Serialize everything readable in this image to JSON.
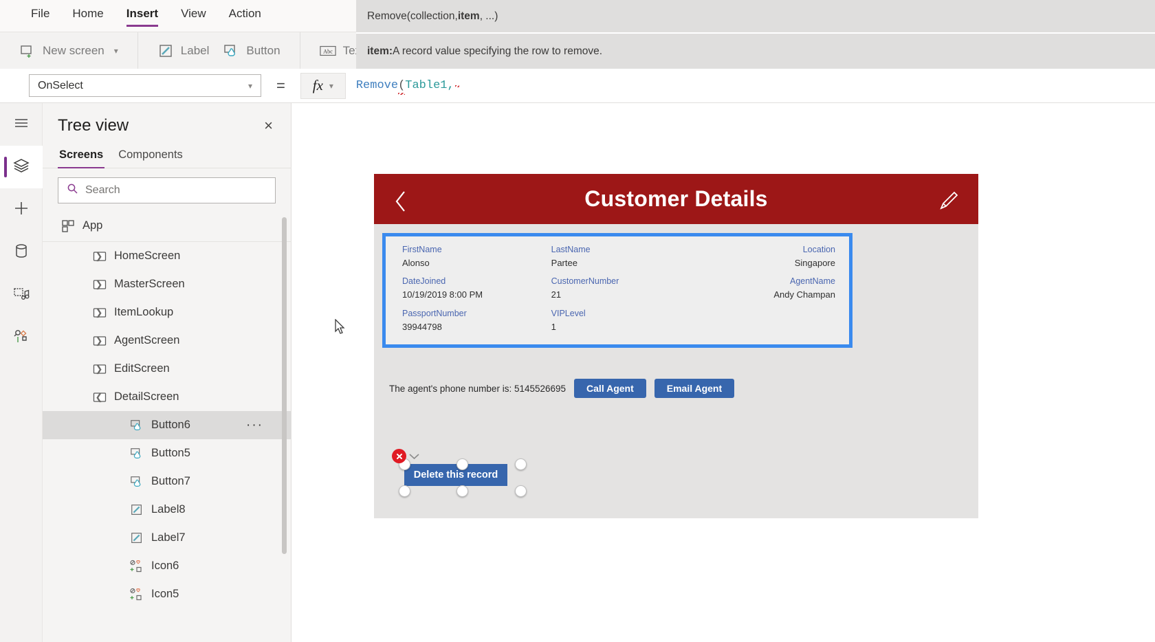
{
  "ribbon": {
    "menus": [
      {
        "label": "File",
        "active": false
      },
      {
        "label": "Home",
        "active": false
      },
      {
        "label": "Insert",
        "active": true
      },
      {
        "label": "View",
        "active": false
      },
      {
        "label": "Action",
        "active": false
      }
    ],
    "commands": [
      {
        "label": "New screen",
        "icon": "new-screen-icon",
        "has_chevron": true
      },
      {
        "label": "Label",
        "icon": "label-icon",
        "has_chevron": false
      },
      {
        "label": "Button",
        "icon": "button-icon",
        "has_chevron": false
      },
      {
        "label": "Text",
        "icon": "text-icon",
        "has_chevron": true
      }
    ]
  },
  "intellisense": {
    "signature_prefix": "Remove(collection, ",
    "signature_bold": "item",
    "signature_suffix": ", ...)",
    "description_bold": "item:",
    "description_text": " A record value specifying the row to remove."
  },
  "formula": {
    "property": "OnSelect",
    "equals": "=",
    "fx_label": "fx",
    "token_fn": "Remove",
    "token_paren": "(",
    "token_table": "Table1",
    "token_comma": ","
  },
  "rail": {
    "items": [
      {
        "name": "hamburger-icon",
        "label": "Menu",
        "active": false
      },
      {
        "name": "layers-icon",
        "label": "Tree view",
        "active": true
      },
      {
        "name": "plus-icon",
        "label": "Insert",
        "active": false
      },
      {
        "name": "database-icon",
        "label": "Data",
        "active": false
      },
      {
        "name": "media-icon",
        "label": "Media",
        "active": false
      },
      {
        "name": "tools-icon",
        "label": "Advanced",
        "active": false
      }
    ]
  },
  "treeview": {
    "title": "Tree view",
    "close_label": "×",
    "tabs": [
      {
        "label": "Screens",
        "active": true
      },
      {
        "label": "Components",
        "active": false
      }
    ],
    "search_placeholder": "Search",
    "search_value": "",
    "app_item": {
      "label": "App",
      "icon": "app-icon"
    },
    "screens": [
      {
        "label": "HomeScreen",
        "expanded": false,
        "icon": "screen-icon"
      },
      {
        "label": "MasterScreen",
        "expanded": false,
        "icon": "screen-icon"
      },
      {
        "label": "ItemLookup",
        "expanded": false,
        "icon": "screen-icon"
      },
      {
        "label": "AgentScreen",
        "expanded": false,
        "icon": "screen-icon"
      },
      {
        "label": "EditScreen",
        "expanded": false,
        "icon": "screen-icon"
      },
      {
        "label": "DetailScreen",
        "expanded": true,
        "icon": "screen-icon"
      }
    ],
    "children": [
      {
        "label": "Button6",
        "icon": "button-icon",
        "selected": true,
        "overflow": "···"
      },
      {
        "label": "Button5",
        "icon": "button-icon",
        "selected": false
      },
      {
        "label": "Button7",
        "icon": "button-icon",
        "selected": false
      },
      {
        "label": "Label8",
        "icon": "label-icon",
        "selected": false
      },
      {
        "label": "Label7",
        "icon": "label-icon",
        "selected": false
      },
      {
        "label": "Icon6",
        "icon": "icon-icon",
        "selected": false
      },
      {
        "label": "Icon5",
        "icon": "icon-icon",
        "selected": false
      }
    ]
  },
  "canvas": {
    "header": {
      "title": "Customer Details",
      "back_icon": "chevron-left-icon",
      "edit_icon": "pencil-icon",
      "background_color": "#9d1717"
    },
    "form": {
      "border_color": "#3a8aee",
      "fields": [
        {
          "label": "FirstName",
          "value": "Alonso",
          "column": 1,
          "row": 1
        },
        {
          "label": "LastName",
          "value": "Partee",
          "column": 2,
          "row": 1
        },
        {
          "label": "Location",
          "value": "Singapore",
          "column": 3,
          "row": 1
        },
        {
          "label": "DateJoined",
          "value": "10/19/2019 8:00 PM",
          "column": 1,
          "row": 2
        },
        {
          "label": "CustomerNumber",
          "value": "21",
          "column": 2,
          "row": 2
        },
        {
          "label": "AgentName",
          "value": "Andy Champan",
          "column": 3,
          "row": 2
        },
        {
          "label": "PassportNumber",
          "value": "39944798",
          "column": 1,
          "row": 3
        },
        {
          "label": "VIPLevel",
          "value": "1",
          "column": 2,
          "row": 3
        },
        {
          "label": "",
          "value": "",
          "column": 3,
          "row": 3
        }
      ]
    },
    "agent": {
      "phone_text": "The agent's phone number is: 5145526695",
      "call_button": "Call Agent",
      "email_button": "Email Agent",
      "button_color": "#3766ad"
    },
    "selected_control": {
      "label": "Delete this record",
      "error_icon": "error-x-icon",
      "error_chevron": "chevron-down-icon",
      "error_color": "#e01b24"
    }
  }
}
